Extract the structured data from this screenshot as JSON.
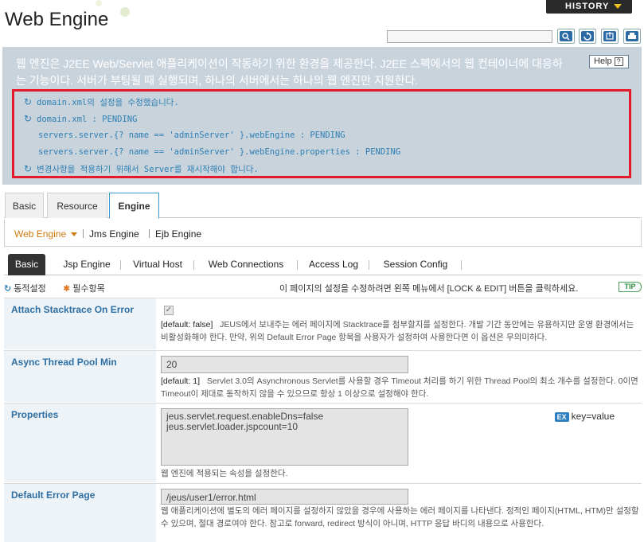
{
  "header": {
    "title": "Web Engine",
    "history_label": "HISTORY",
    "search_placeholder": ""
  },
  "info": {
    "description": "웹 엔진은 J2EE Web/Servlet 애플리케이션이 작동하기 위한 환경을 제공한다. J2EE 스펙에서의 웹 컨테이너에 대응하는 기능이다. 서버가 부팅될 때 실행되며, 하나의 서버에서는 하나의 웹 엔진만 지원한다.",
    "help_label": "Help",
    "messages": [
      {
        "text": "domain.xml의 설정을 수정했습니다.",
        "icon": true
      },
      {
        "text": "domain.xml : PENDING",
        "icon": true
      },
      {
        "text": "servers.server.{? name == 'adminServer' }.webEngine : PENDING",
        "icon": false
      },
      {
        "text": "servers.server.{? name == 'adminServer' }.webEngine.properties : PENDING",
        "icon": false
      },
      {
        "text": "변경사항을 적용하기 위해서 Server를 재시작해야 합니다.",
        "icon": true
      }
    ]
  },
  "tabs": [
    "Basic",
    "Resource",
    "Engine"
  ],
  "subnav": {
    "items": [
      "Web Engine",
      "Jms Engine",
      "Ejb Engine"
    ]
  },
  "subtabs": [
    "Basic",
    "Jsp Engine",
    "Virtual Host",
    "Web Connections",
    "Access Log",
    "Session Config"
  ],
  "legend": {
    "dynamic": "동적설정",
    "required": "필수항목",
    "notice": "이 페이지의 설정을 수정하려면 왼쪽 메뉴에서 [LOCK & EDIT] 버튼을 클릭하세요.",
    "tip": "TIP"
  },
  "properties": [
    {
      "label": "Attach Stacktrace On Error",
      "default": "[default: false]",
      "description": "JEUS에서 보내주는 에러 페이지에 Stacktrace를 첨부할지를 설정한다. 개발 기간 동안에는 유용하지만 운영 환경에서는 비활성화해야 한다. 만약, 위의 Default Error Page 항목을 사용자가 설정하여 사용한다면 이 옵션은 무의미하다."
    },
    {
      "label": "Async Thread Pool Min",
      "value": "20",
      "default": "[default: 1]",
      "description": "Servlet 3.0의 Asynchronous Servlet를 사용할 경우 Timeout 처리를 하기 위한 Thread Pool의 최소 개수를 설정한다. 0이면 Timeout이 제대로 동작하지 않을 수 있으므로 항상 1 이상으로 설정해야 한다."
    },
    {
      "label": "Properties",
      "value_line1": "jeus.servlet.request.enableDns=false",
      "value_line2": "jeus.servlet.loader.jspcount=10",
      "ex_badge": "EX",
      "ex_text": "key=value",
      "description": "웹 엔진에 적용되는 속성을 설정한다."
    },
    {
      "label": "Default Error Page",
      "value": "/jeus/user1/error.html",
      "description": "웹 애플리케이션에 별도의 에러 페이지를 설정하지 않았을 경우에 사용하는 에러 페이지를 나타낸다. 정적인 페이지(HTML, HTM)만 설정할 수 있으며, 절대 경로여야 한다. 참고로 forward, redirect 방식이 아니며, HTTP 응답 바디의 내용으로 사용한다."
    }
  ],
  "colors": {
    "accent": "#3a9ad0",
    "message_border": "#e8182b",
    "panel_bg": "#c9d3dc",
    "active_subnav": "#d07a10"
  }
}
